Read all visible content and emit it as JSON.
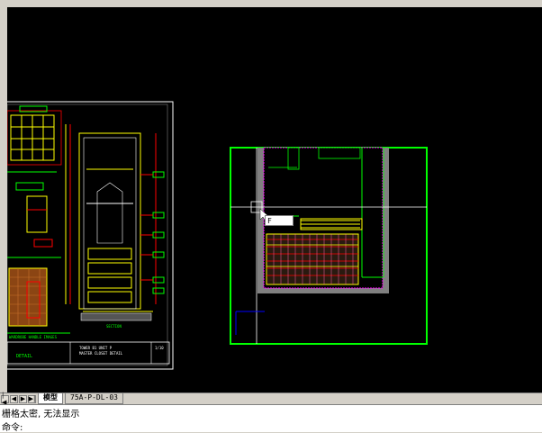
{
  "layout_tabs": {
    "nav_buttons": [
      "|◀",
      "◀",
      "▶",
      "▶|"
    ],
    "items": [
      {
        "label": "模型",
        "active": true
      },
      {
        "label": "75A-P-DL-03",
        "active": false
      }
    ]
  },
  "command_area": {
    "history_line": "栅格太密, 无法显示",
    "prompt_label": "命令:"
  },
  "drawing": {
    "sheet_labels": {
      "section_label": "SECTION",
      "wardrobe_label": "WARDROBE HANDLE IMAGES",
      "title_block_line1": "TOWER B1 UNIT P",
      "title_block_line2": "MASTER CLOSET DETAIL",
      "detail_tag": "DETAIL",
      "small_label": "1/10"
    },
    "floating_text_field": "F",
    "colors": {
      "background": "#000000",
      "green": "#00ff00",
      "yellow": "#ffff00",
      "red": "#ff0000",
      "cyan": "#00ffff",
      "white": "#ffffff",
      "magenta": "#ff00ff",
      "gray": "#808080",
      "blue": "#0000ff"
    }
  }
}
